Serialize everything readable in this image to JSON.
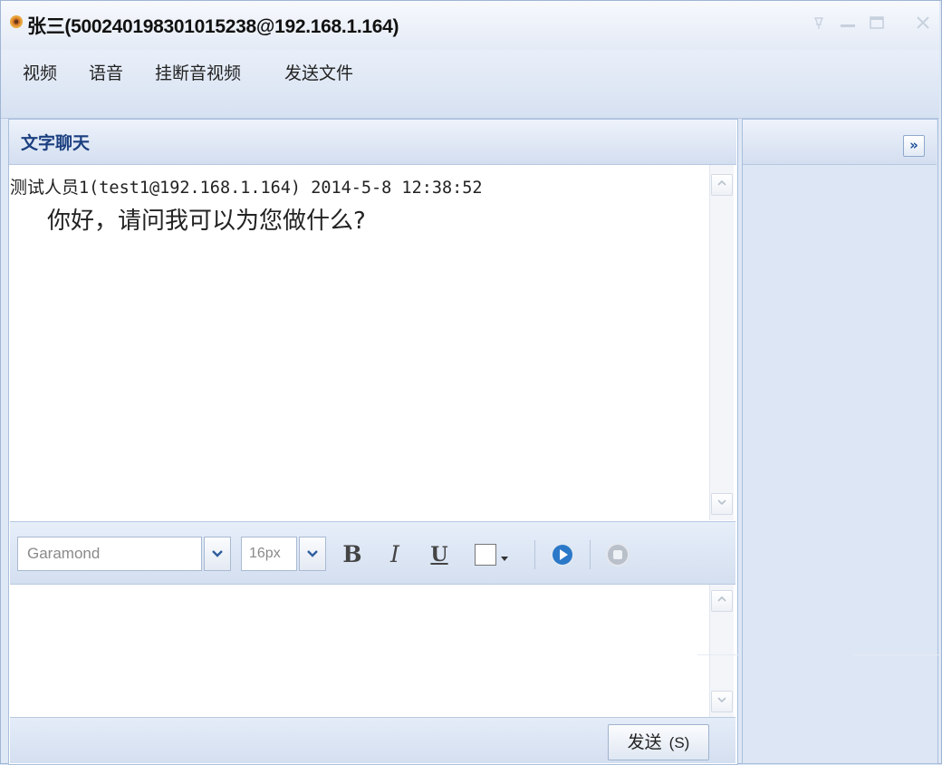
{
  "window": {
    "title": "张三(500240198301015238@192.168.1.164)",
    "icon": "sunflower-icon",
    "controls": [
      "pin-icon",
      "minimize-icon",
      "maximize-icon",
      "close-icon"
    ]
  },
  "menu": {
    "items": [
      {
        "label": "视频"
      },
      {
        "label": "语音"
      },
      {
        "label": "挂断音视频"
      },
      {
        "label": "发送文件"
      }
    ]
  },
  "chat": {
    "header_title": "文字聊天",
    "messages": [
      {
        "sender_cn": "测试人员",
        "meta_rest": "1(test1@192.168.1.164) 2014-5-8 12:38:52",
        "text": "你好，请问我可以为您做什么?"
      }
    ]
  },
  "toolbar": {
    "font_family": "Garamond",
    "font_size": "16px",
    "bold_label": "B",
    "italic_label": "I",
    "underline_label": "U",
    "icons": [
      "bold-icon",
      "italic-icon",
      "underline-icon",
      "color-picker-icon",
      "play-icon",
      "stop-icon"
    ]
  },
  "input": {
    "value": ""
  },
  "send_button": {
    "label": "发送",
    "hotkey": "(S)"
  },
  "right_panel": {
    "expand_icon": "»"
  },
  "colors": {
    "frame": "#dfe8f5",
    "header_text": "#1b3f80",
    "border": "#a9bfdc",
    "play_blue": "#2b78c8"
  }
}
